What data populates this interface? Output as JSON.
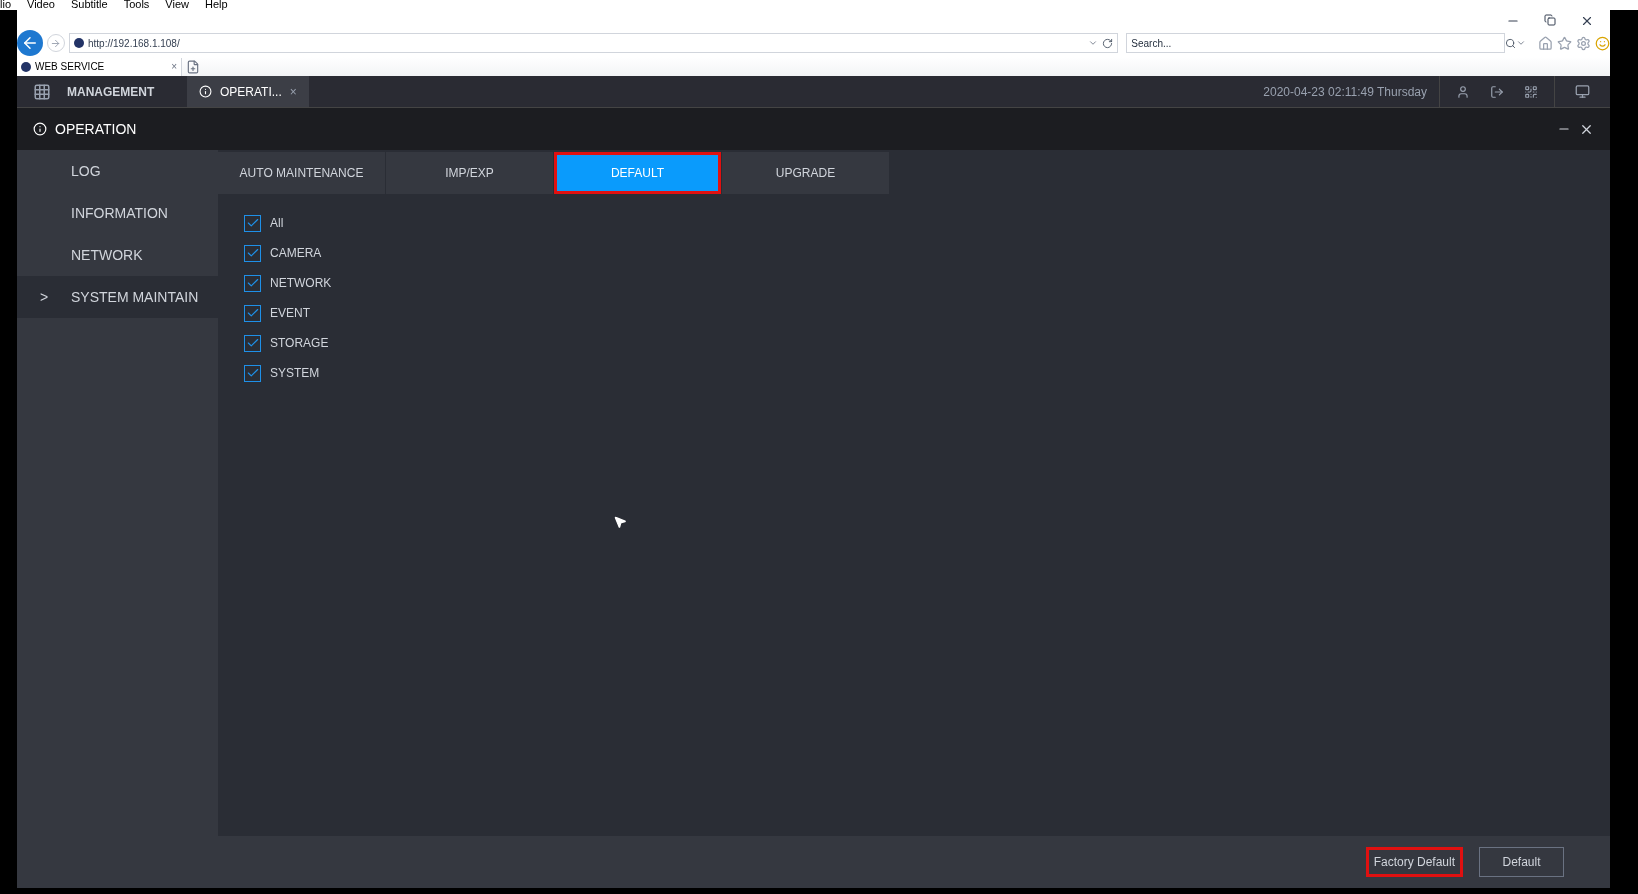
{
  "menu_bar": [
    "lio",
    "Video",
    "Subtitle",
    "Tools",
    "View",
    "Help"
  ],
  "browser": {
    "address": "http://192.168.1.108/",
    "search": {
      "placeholder": "Search..."
    },
    "tab": {
      "title": "WEB SERVICE",
      "close": "×"
    }
  },
  "app_header": {
    "main": "MANAGEMENT",
    "open_tab": {
      "label": "OPERATI...",
      "close": "×"
    },
    "datetime": "2020-04-23 02:11:49 Thursday"
  },
  "panel": {
    "title": "OPERATION"
  },
  "sidebar": {
    "items": [
      {
        "label": "LOG",
        "selected": false
      },
      {
        "label": "INFORMATION",
        "selected": false
      },
      {
        "label": "NETWORK",
        "selected": false
      },
      {
        "label": "SYSTEM MAINTAIN",
        "selected": true
      }
    ],
    "chevron": ">"
  },
  "tabs": [
    {
      "label": "AUTO MAINTENANCE",
      "selected": false,
      "highlighted": false
    },
    {
      "label": "IMP/EXP",
      "selected": false,
      "highlighted": false
    },
    {
      "label": "DEFAULT",
      "selected": true,
      "highlighted": true
    },
    {
      "label": "UPGRADE",
      "selected": false,
      "highlighted": false
    }
  ],
  "options": [
    {
      "label": "All",
      "checked": true
    },
    {
      "label": "CAMERA",
      "checked": true
    },
    {
      "label": "NETWORK",
      "checked": true
    },
    {
      "label": "EVENT",
      "checked": true
    },
    {
      "label": "STORAGE",
      "checked": true
    },
    {
      "label": "SYSTEM",
      "checked": true
    }
  ],
  "buttons": [
    {
      "label": "Factory Default",
      "highlighted": true,
      "outlined": false
    },
    {
      "label": "Default",
      "highlighted": false,
      "outlined": true
    }
  ]
}
